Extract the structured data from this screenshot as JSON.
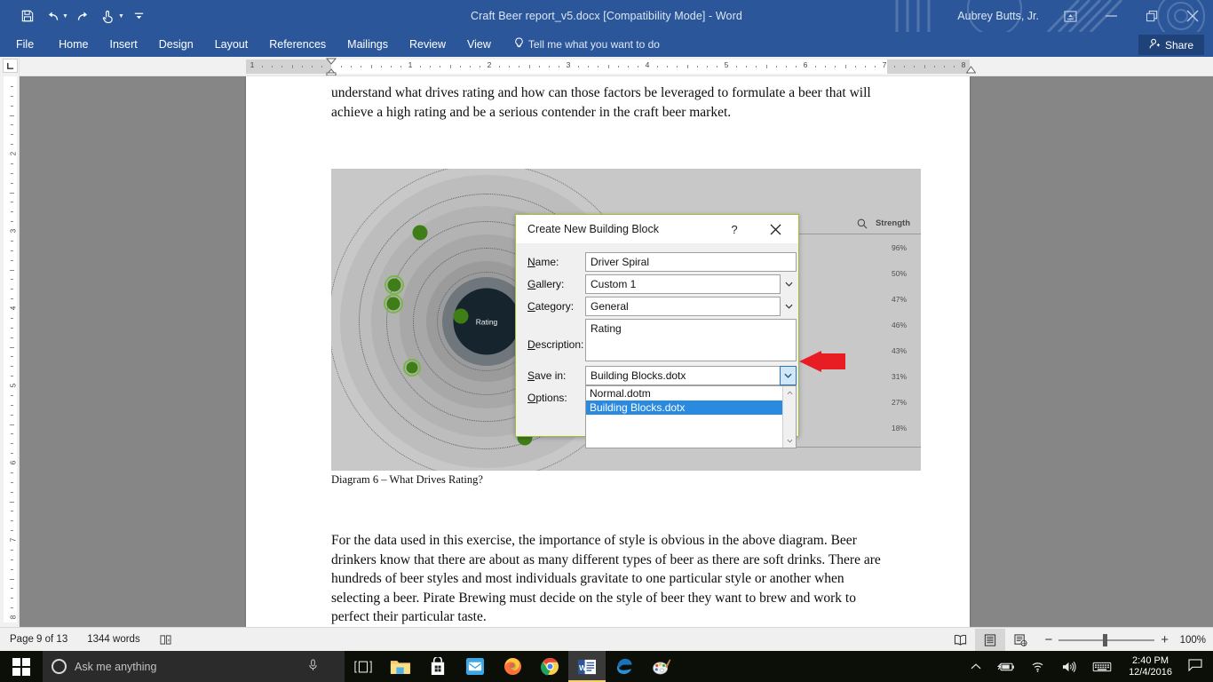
{
  "titlebar": {
    "document_title": "Craft Beer report_v5.docx [Compatibility Mode] - Word",
    "user_name": "Aubrey Butts, Jr.",
    "quick_access": [
      {
        "name": "save-icon",
        "glyph": "💾"
      },
      {
        "name": "undo-icon",
        "glyph": "↶"
      },
      {
        "name": "redo-icon",
        "glyph": "↷"
      },
      {
        "name": "touch-mode-icon",
        "glyph": "☝"
      },
      {
        "name": "customize-quick-access-icon",
        "glyph": "⌄"
      }
    ],
    "window_controls": {
      "ribbon_display": "⬆",
      "minimize": "—",
      "restore": "❐",
      "close": "✕"
    }
  },
  "ribbon": {
    "tabs": [
      "File",
      "Home",
      "Insert",
      "Design",
      "Layout",
      "References",
      "Mailings",
      "Review",
      "View"
    ],
    "tell_me": "Tell me what you want to do",
    "share_label": "Share"
  },
  "ruler": {
    "horizontal_numbers": [
      "1",
      "1",
      "2",
      "3",
      "4",
      "5",
      "6",
      "7"
    ],
    "vertical_numbers": [
      "1",
      "2",
      "3",
      "4",
      "5",
      "6",
      "7"
    ]
  },
  "document": {
    "paragraph_top": "understand what drives rating and how can those factors be leveraged to formulate a beer that will achieve a high rating and be a serious contender in the craft beer market.",
    "caption": "Diagram 6 – What Drives Rating?",
    "paragraph_bottom": "For the data used in this exercise, the importance of style is obvious in the above diagram.  Beer drinkers know that there are about as many different types of beer as there are soft drinks.  There are hundreds of beer styles and most individuals gravitate to one particular style or another when selecting a beer.  Pirate Brewing must decide on the style of beer they want to brew and work to perfect their particular taste."
  },
  "diagram": {
    "center_label": "Rating",
    "strength_header": "Strength",
    "search_icon": "🔍",
    "strength_values": [
      "96%",
      "50%",
      "47%",
      "46%",
      "43%",
      "31%",
      "27%",
      "18%"
    ]
  },
  "dialog": {
    "title": "Create New Building Block",
    "help_glyph": "?",
    "close_glyph": "✕",
    "fields": [
      {
        "label_pre": "N",
        "label_key": "N",
        "label_rest": "ame:",
        "value": "Driver Spiral",
        "type": "text"
      },
      {
        "label_pre": "G",
        "label_key": "G",
        "label_rest": "allery:",
        "value": "Custom 1",
        "type": "combo"
      },
      {
        "label_pre": "C",
        "label_key": "C",
        "label_rest": "ategory:",
        "value": "General",
        "type": "combo"
      },
      {
        "label_pre": "D",
        "label_key": "D",
        "label_rest": "escription:",
        "value": "Rating",
        "type": "textarea"
      },
      {
        "label_pre": "S",
        "label_key": "S",
        "label_rest": "ave in:",
        "value": "Building Blocks.dotx",
        "type": "combo"
      },
      {
        "label_pre": "O",
        "label_key": "O",
        "label_rest": "ptions:",
        "value": "",
        "type": "combo"
      }
    ],
    "name_label": "Name:",
    "gallery_label": "Gallery:",
    "category_label": "Category:",
    "description_label": "Description:",
    "save_in_label": "Save in:",
    "options_label": "Options:",
    "name_value": "Driver Spiral",
    "gallery_value": "Custom 1",
    "category_value": "General",
    "description_value": "Rating",
    "save_in_value": "Building Blocks.dotx",
    "dropdown_options": [
      "Normal.dotm",
      "Building Blocks.dotx"
    ],
    "dropdown_selected": "Building Blocks.dotx",
    "chevron_glyph": "⌄"
  },
  "statusbar": {
    "page_info": "Page 9 of 13",
    "word_count": "1344 words",
    "proofing_icon": "📖",
    "views": [
      {
        "name": "read-mode-view-button",
        "glyph": "📖",
        "active": false
      },
      {
        "name": "print-layout-view-button",
        "glyph": "☰",
        "active": true
      },
      {
        "name": "web-layout-view-button",
        "glyph": "📄",
        "active": false
      }
    ],
    "zoom_out": "−",
    "zoom_in": "+",
    "zoom_level": "100%"
  },
  "taskbar": {
    "search_placeholder": "Ask me anything",
    "apps": [
      {
        "name": "file-explorer-icon",
        "active": false
      },
      {
        "name": "microsoft-store-icon",
        "active": false
      },
      {
        "name": "mail-icon",
        "active": false
      },
      {
        "name": "firefox-icon",
        "active": false
      },
      {
        "name": "chrome-icon",
        "active": false
      },
      {
        "name": "word-icon",
        "active": true
      },
      {
        "name": "edge-icon",
        "active": false
      },
      {
        "name": "paint-icon",
        "active": false
      }
    ],
    "tray": {
      "show_hidden": "∧",
      "battery": "🔋",
      "network": "📶",
      "volume": "🔊",
      "keyboard": "⌨",
      "time": "2:40 PM",
      "date": "12/4/2016",
      "action_center": "💬"
    }
  },
  "colors": {
    "word_blue": "#2b579a",
    "dialog_border": "#9fbf3b",
    "highlight_blue": "#2a8ae0",
    "arrow_red": "#e81d24",
    "dot_green": "#3f7d17"
  }
}
